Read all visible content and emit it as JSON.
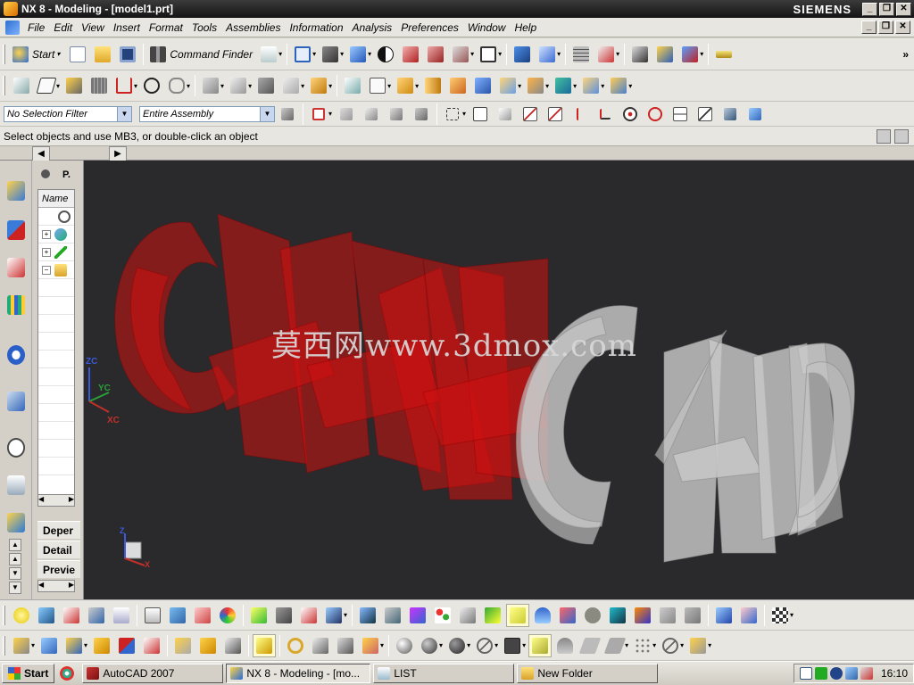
{
  "window": {
    "title": "NX 8 - Modeling - [model1.prt]",
    "brand": "SIEMENS",
    "minimize": "_",
    "maximize": "❐",
    "close": "✕"
  },
  "menu": {
    "items": [
      "File",
      "Edit",
      "View",
      "Insert",
      "Format",
      "Tools",
      "Assemblies",
      "Information",
      "Analysis",
      "Preferences",
      "Window",
      "Help"
    ]
  },
  "toolbar_standard": {
    "start_label": "Start",
    "command_finder_label": "Command Finder",
    "overflow": "»"
  },
  "selection_bar": {
    "filter_value": "No Selection Filter",
    "scope_value": "Entire Assembly"
  },
  "cue_line": {
    "text": "Select objects and use MB3, or double-click an object"
  },
  "navigator": {
    "tab_label": "P.",
    "column_header": "Name",
    "sections": [
      "Deper",
      "Detail",
      "Previe"
    ]
  },
  "graphics": {
    "watermark": "莫西网www.3dmox.com",
    "wcs": {
      "z": "ZC",
      "y": "YC",
      "x": "XC"
    },
    "triad": {
      "z": "Z",
      "x": "X"
    },
    "colors": {
      "background": "#2a2a2c",
      "red_text": "#d01010",
      "grey_text": "#c8c8c8"
    }
  },
  "taskbar": {
    "start_label": "Start",
    "tasks": [
      "AutoCAD 2007",
      "NX 8 - Modeling - [mo...",
      "LIST",
      "New Folder"
    ],
    "clock": "16:10"
  }
}
